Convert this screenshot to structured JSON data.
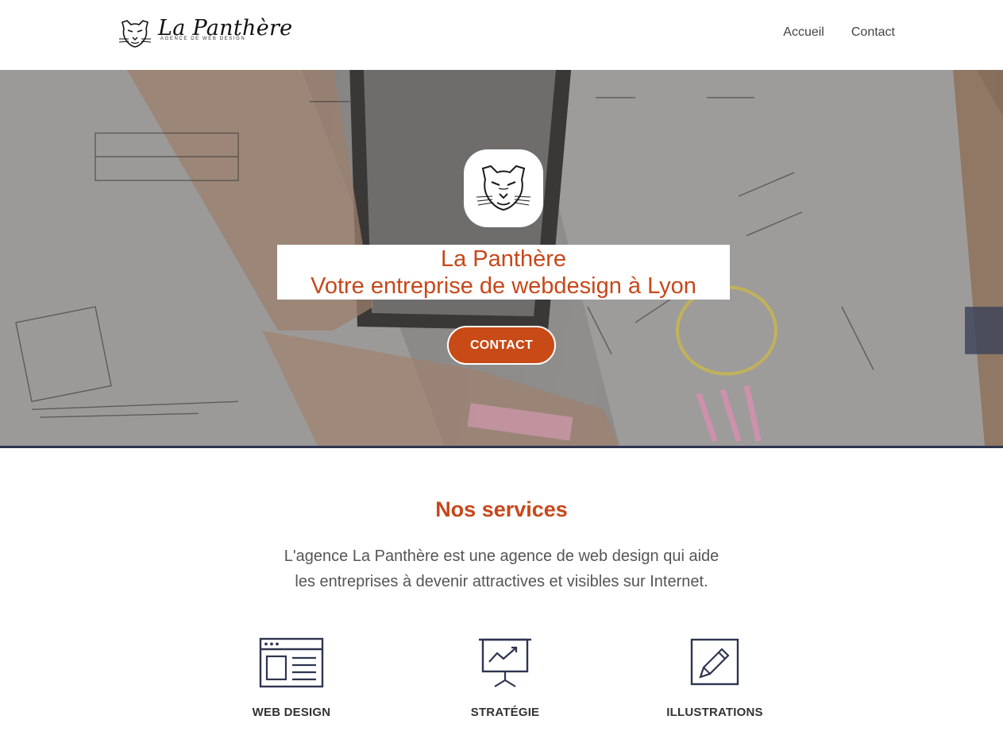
{
  "header": {
    "logo_title": "La Panthère",
    "logo_subtitle": "AGENCE DE WEB DESIGN",
    "nav": [
      {
        "label": "Accueil"
      },
      {
        "label": "Contact"
      }
    ]
  },
  "hero": {
    "title_line1": "La Panthère",
    "title_line2": "Votre entreprise de webdesign à Lyon",
    "cta_label": "CONTACT",
    "panther_icon": "panther-head-icon"
  },
  "services": {
    "title": "Nos services",
    "desc_line1": "L'agence La Panthère est une agence de web design qui aide",
    "desc_line2": "les entreprises à devenir attractives et visibles sur Internet.",
    "items": [
      {
        "label": "WEB DESIGN",
        "icon": "browser-window-icon"
      },
      {
        "label": "STRATÉGIE",
        "icon": "presentation-chart-icon"
      },
      {
        "label": "ILLUSTRATIONS",
        "icon": "pencil-square-icon"
      }
    ]
  },
  "colors": {
    "accent": "#c7471a",
    "button": "#c84a16",
    "icon_stroke": "#2e3550",
    "hero_border": "#2e3550"
  }
}
